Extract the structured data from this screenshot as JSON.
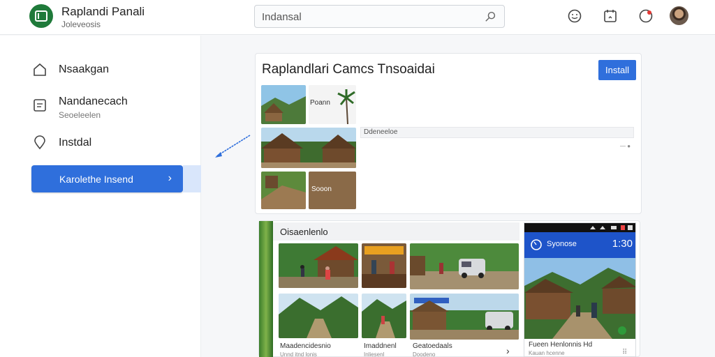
{
  "header": {
    "app_title": "Raplandi Panali",
    "app_subtitle": "Joleveosis",
    "search_value": "Indansal",
    "icons": [
      "search-icon",
      "emoji-icon",
      "calendar-icon",
      "notification-icon"
    ]
  },
  "sidebar": {
    "items": [
      {
        "label": "Nsaakgan",
        "icon": "home-icon"
      },
      {
        "label": "Nandanecach",
        "sublabel": "Seoeleelen",
        "icon": "document-icon"
      },
      {
        "label": "Instdal",
        "icon": "location-pin-icon"
      }
    ],
    "primary_button": "Karolethe Insend",
    "primary_chevron": "›"
  },
  "app_card": {
    "title": "Raplandlari Camcs Tnsoaidai",
    "install_label": "Install",
    "thumb_labels": [
      "Poann",
      "Sooon"
    ],
    "description_label": "Ddeneeloe"
  },
  "gallery": {
    "title": "Oisaenlenlo",
    "captions": [
      "Maadencidesnio",
      "Imaddnenl",
      "Geatoedaals"
    ],
    "subcaptions": [
      "Unnd itnd lonis",
      "Inliesenl",
      "Doodeno"
    ]
  },
  "phone": {
    "name": "Syonose",
    "time": "1:30",
    "caption": "Fueen Henlonnis Hd",
    "subcaption": "Kauan hcenne"
  },
  "colors": {
    "primary": "#2f6fdc",
    "logo": "#1f7a3a"
  }
}
